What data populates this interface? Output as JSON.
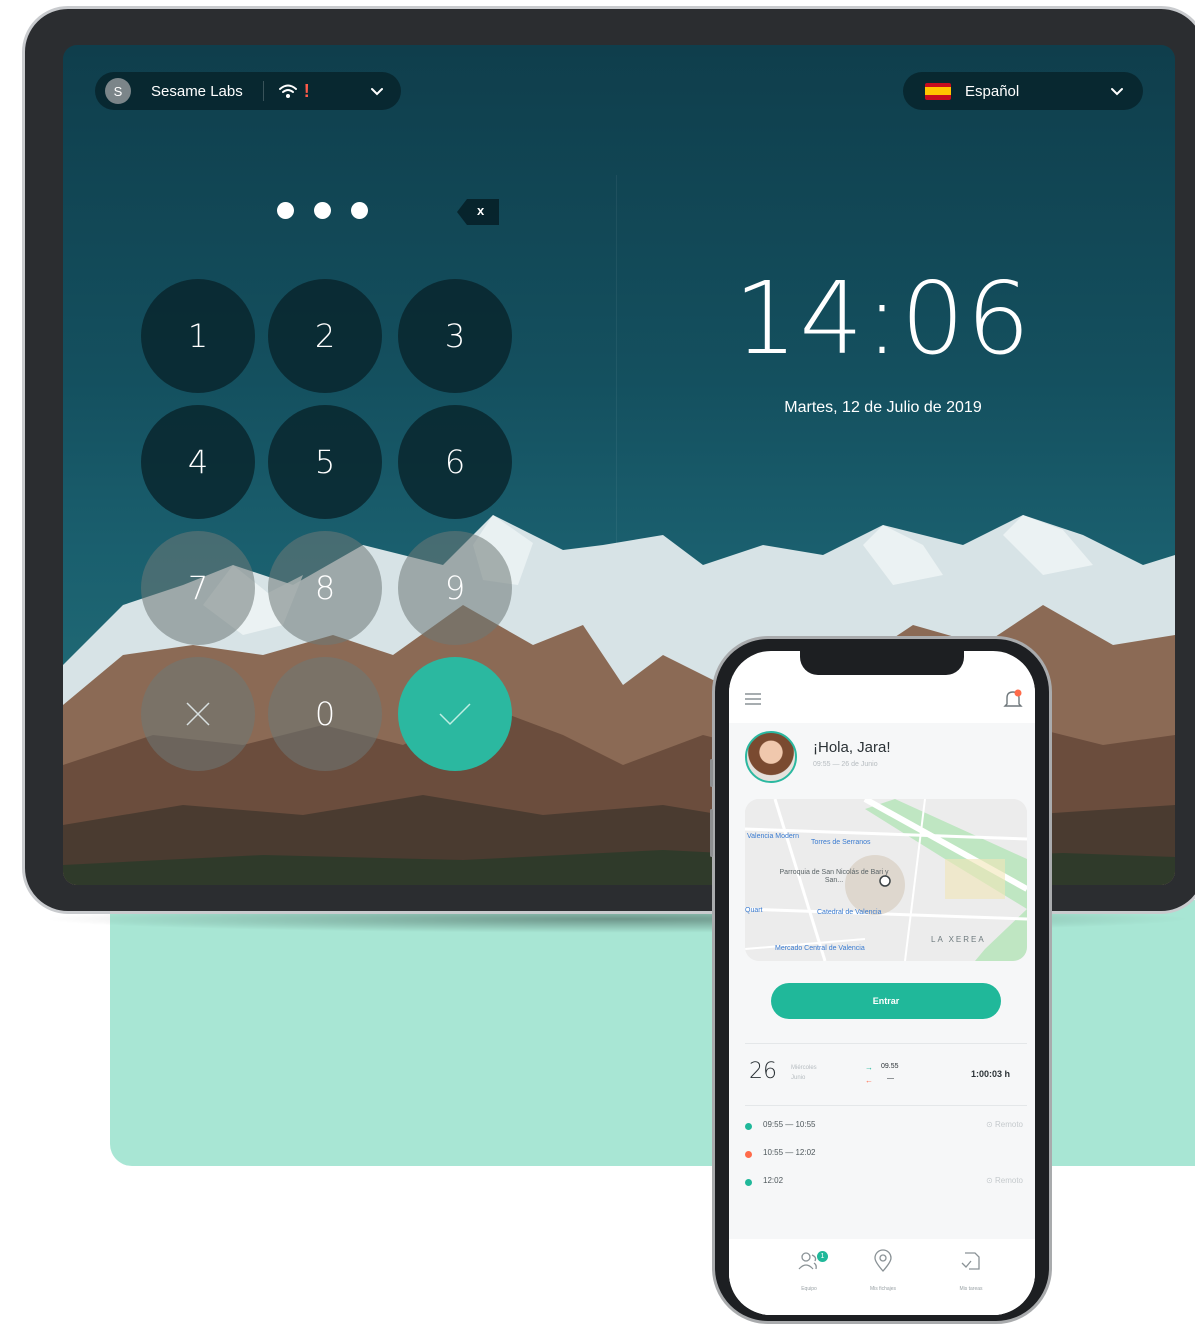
{
  "tablet": {
    "org": {
      "initial": "S",
      "name": "Sesame Labs",
      "warning": "!"
    },
    "language": {
      "label": "Español"
    },
    "pin": {
      "backspace_label": "x"
    },
    "keypad": {
      "k1": "1",
      "k2": "2",
      "k3": "3",
      "k4": "4",
      "k5": "5",
      "k6": "6",
      "k7": "7",
      "k8": "8",
      "k9": "9",
      "k0": "0"
    },
    "clock": {
      "time": "14:06",
      "date": "Martes, 12 de Julio de 2019"
    }
  },
  "phone": {
    "greeting": "¡Hola, Jara!",
    "greeting_sub": "09:55 — 26 de Junio",
    "map": {
      "label_1": "Torres de Serranos",
      "label_2": "Parroquia de San Nicolás de Bari y San...",
      "label_3": "Catedral de Valencia",
      "label_4": "Mercado Central de Valencia",
      "label_5": "LA XEREA",
      "label_6": "Valencia Modern",
      "label_7": "Quart"
    },
    "enter_button": "Entrar",
    "summary": {
      "day_number": "26",
      "day_name": "Miércoles",
      "month": "Junio",
      "in_time": "09.55",
      "out_time": "—",
      "total": "1:00:03 h"
    },
    "entries": [
      {
        "time": "09:55 — 10:55",
        "location": "Remoto",
        "color": "#20b89a"
      },
      {
        "time": "10:55 — 12:02",
        "location": "",
        "color": "#ff6b4a"
      },
      {
        "time": "12:02",
        "location": "Remoto",
        "color": "#20b89a"
      }
    ],
    "tabs": {
      "team": "Equipo",
      "team_badge": "1",
      "checkins": "Mis fichajes",
      "tasks": "Mis tareas"
    }
  },
  "colors": {
    "accent": "#20b89a",
    "mint": "#a8e6d4",
    "screen_dark": "#0f3e4c",
    "alert": "#ff5b4a"
  },
  "icons": [
    "wifi-icon",
    "chevron-down-icon",
    "spain-flag-icon",
    "backspace-icon",
    "close-icon",
    "check-icon",
    "hamburger-icon",
    "bell-icon",
    "team-icon",
    "location-pin-icon",
    "tasks-icon"
  ]
}
